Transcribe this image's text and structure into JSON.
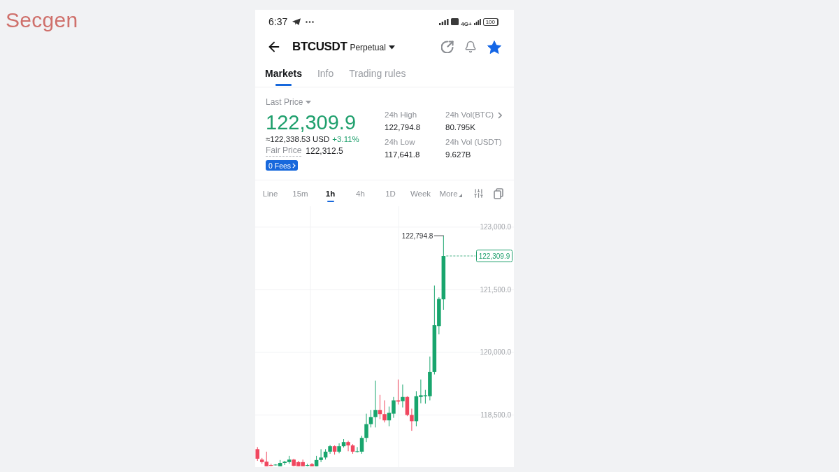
{
  "brand": {
    "text": "Secgen"
  },
  "status_bar": {
    "time": "6:37",
    "network": "4G+",
    "battery": "100"
  },
  "header": {
    "symbol": "BTCUSDT",
    "contract": "Perpetual",
    "favorite": true
  },
  "tabs": [
    {
      "label": "Markets",
      "selected": true
    },
    {
      "label": "Info",
      "selected": false
    },
    {
      "label": "Trading rules",
      "selected": false
    }
  ],
  "price": {
    "label": "Last Price",
    "last": "122,309.9",
    "usd": "≈122,338.53 USD",
    "change": "+3.11%",
    "fair_label": "Fair Price",
    "fair": "122,312.5",
    "fees_badge": "0 Fees"
  },
  "stats": [
    {
      "label": "24h High",
      "value": "122,794.8"
    },
    {
      "label": "24h Vol(BTC)",
      "value": "80.795K"
    },
    {
      "label": "24h Low",
      "value": "117,641.8"
    },
    {
      "label": "24h Vol (USDT)",
      "value": "9.627B"
    }
  ],
  "intervals": [
    {
      "label": "Line",
      "selected": false
    },
    {
      "label": "15m",
      "selected": false
    },
    {
      "label": "1h",
      "selected": true
    },
    {
      "label": "4h",
      "selected": false
    },
    {
      "label": "1D",
      "selected": false
    },
    {
      "label": "Week",
      "selected": false
    }
  ],
  "more": "More",
  "chart": {
    "chart_data": {
      "type": "candlestick",
      "categories": [
        null,
        null,
        null,
        null,
        null,
        null,
        null,
        null,
        null,
        null,
        null,
        null,
        null,
        null,
        null,
        null,
        null,
        null,
        null,
        null,
        null,
        null,
        null,
        null,
        null,
        null,
        null,
        null,
        null,
        null,
        null,
        null,
        null,
        null,
        null,
        null,
        null,
        null,
        null,
        null,
        null,
        null
      ],
      "ohlc": [
        [
          117680,
          117730,
          117400,
          117450
        ],
        [
          117430,
          117470,
          117330,
          117370
        ],
        [
          117380,
          117620,
          117270,
          117270
        ],
        [
          117300,
          117330,
          117270,
          117280
        ],
        [
          117300,
          117320,
          117290,
          117310
        ],
        [
          117270,
          117420,
          117270,
          117350
        ],
        [
          117350,
          117400,
          117300,
          117380
        ],
        [
          117370,
          117520,
          117330,
          117430
        ],
        [
          117430,
          117450,
          117270,
          117280
        ],
        [
          117370,
          117400,
          117270,
          117270
        ],
        [
          117370,
          117430,
          117270,
          117270
        ],
        [
          117280,
          117330,
          117270,
          117300
        ],
        [
          117320,
          117350,
          117270,
          117270
        ],
        [
          117270,
          117520,
          117270,
          117420
        ],
        [
          117420,
          117680,
          117370,
          117480
        ],
        [
          117480,
          117680,
          117430,
          117620
        ],
        [
          117620,
          117780,
          117570,
          117750
        ],
        [
          117750,
          117770,
          117550,
          117620
        ],
        [
          117620,
          117820,
          117580,
          117750
        ],
        [
          117750,
          117920,
          117720,
          117850
        ],
        [
          117850,
          117880,
          117630,
          117770
        ],
        [
          117770,
          117800,
          117570,
          117620
        ],
        [
          117620,
          117730,
          117600,
          117630
        ],
        [
          117620,
          118000,
          117570,
          117950
        ],
        [
          117950,
          118530,
          117850,
          118280
        ],
        [
          118280,
          118620,
          118200,
          118450
        ],
        [
          118450,
          119320,
          118200,
          118620
        ],
        [
          118620,
          118980,
          118400,
          118520
        ],
        [
          118520,
          118850,
          118320,
          118370
        ],
        [
          118370,
          118700,
          118230,
          118550
        ],
        [
          118530,
          118930,
          118430,
          118850
        ],
        [
          118850,
          119350,
          118750,
          118820
        ],
        [
          118830,
          119230,
          118680,
          118930
        ],
        [
          118930,
          118950,
          118470,
          118500
        ],
        [
          118500,
          118650,
          118120,
          118350
        ],
        [
          118350,
          119070,
          118230,
          118950
        ],
        [
          118930,
          119350,
          118780,
          118970
        ],
        [
          118950,
          119100,
          118770,
          118970
        ],
        [
          118950,
          119900,
          118850,
          119530
        ],
        [
          119530,
          121600,
          119470,
          120650
        ],
        [
          120630,
          121320,
          120430,
          121280
        ],
        [
          121270,
          122794.8,
          121020,
          122309.9
        ]
      ],
      "ylim": [
        117250,
        123500
      ],
      "yticks": [
        {
          "value": 118500,
          "label": "118,500.0"
        },
        {
          "value": 120000,
          "label": "120,000.0"
        },
        {
          "value": 121500,
          "label": "121,500.0"
        },
        {
          "value": 123000,
          "label": "123,000.0"
        }
      ],
      "grid": true,
      "annotations": [
        "122,794.8"
      ],
      "ref_lines": [
        {
          "label": "122,309.9"
        }
      ]
    }
  }
}
